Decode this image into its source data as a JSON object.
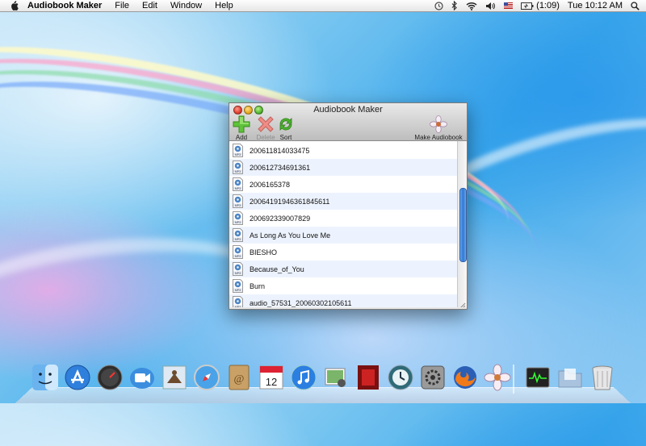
{
  "menubar": {
    "app_name": "Audiobook Maker",
    "menus": [
      "File",
      "Edit",
      "Window",
      "Help"
    ],
    "battery": "(1:09)",
    "clock": "Tue 10:12 AM"
  },
  "window": {
    "title": "Audiobook Maker",
    "toolbar": {
      "add": "Add",
      "delete": "Delete",
      "sort": "Sort",
      "make": "Make Audiobook"
    },
    "files": [
      {
        "name": "200611814033475",
        "type": "MP3"
      },
      {
        "name": "200612734691361",
        "type": "MP3"
      },
      {
        "name": "2006165378",
        "type": "MP3"
      },
      {
        "name": "20064191946361845611",
        "type": "MP3"
      },
      {
        "name": "200692339007829",
        "type": "MP3"
      },
      {
        "name": "As Long As You Love Me",
        "type": "MP3"
      },
      {
        "name": "BIESHO",
        "type": "MP3"
      },
      {
        "name": "Because_of_You",
        "type": "MP3"
      },
      {
        "name": "Burn",
        "type": "MP3"
      },
      {
        "name": "audio_57531_20060302105611",
        "type": "MP3"
      }
    ]
  },
  "dock": {
    "items": [
      "finder-icon",
      "app-store-icon",
      "dashboard-icon",
      "facetime-icon",
      "mail-icon",
      "safari-icon",
      "address-book-icon",
      "ical-icon",
      "itunes-icon",
      "iphoto-icon",
      "photo-booth-icon",
      "time-machine-icon",
      "system-preferences-icon",
      "firefox-icon",
      "audiobook-maker-icon",
      "activity-monitor-icon",
      "documents-folder-icon",
      "trash-icon"
    ],
    "ical_date": "12"
  },
  "colors": {
    "accent": "#2f78d6",
    "alt_row": "#edf3fe",
    "add_green": "#4fb82a",
    "delete_red": "#e0605a"
  }
}
